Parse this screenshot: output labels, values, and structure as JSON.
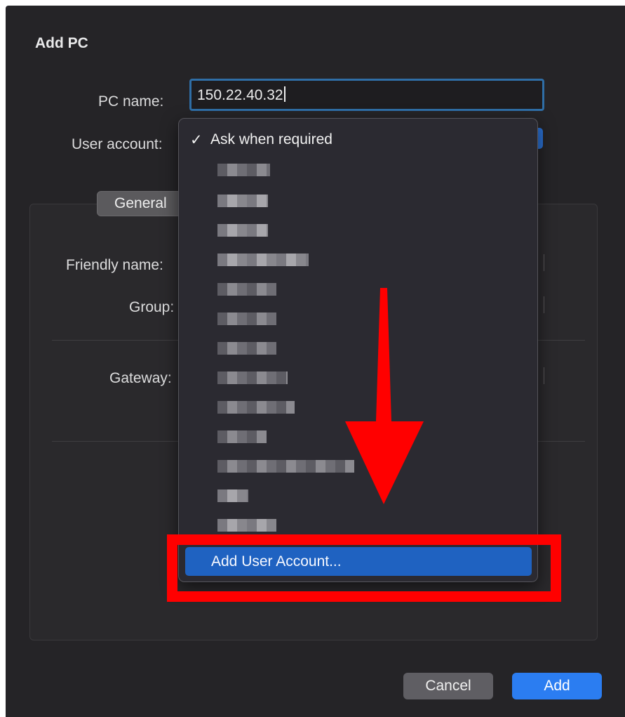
{
  "dialog": {
    "title": "Add PC",
    "pc_name_label": "PC name:",
    "pc_name_value": "150.22.40.32",
    "user_account_label": "User account:",
    "tab_general": "General",
    "friendly_name_label": "Friendly name:",
    "group_label": "Group:",
    "gateway_label": "Gateway:",
    "cancel_label": "Cancel",
    "add_label": "Add"
  },
  "dropdown": {
    "selected_mark": "✓",
    "items": [
      "Ask when required"
    ],
    "redacted_item_count": 13,
    "add_user_account_label": "Add User Account..."
  },
  "colors": {
    "accent": "#2b7df1",
    "highlight_annotation": "#ff0000"
  }
}
